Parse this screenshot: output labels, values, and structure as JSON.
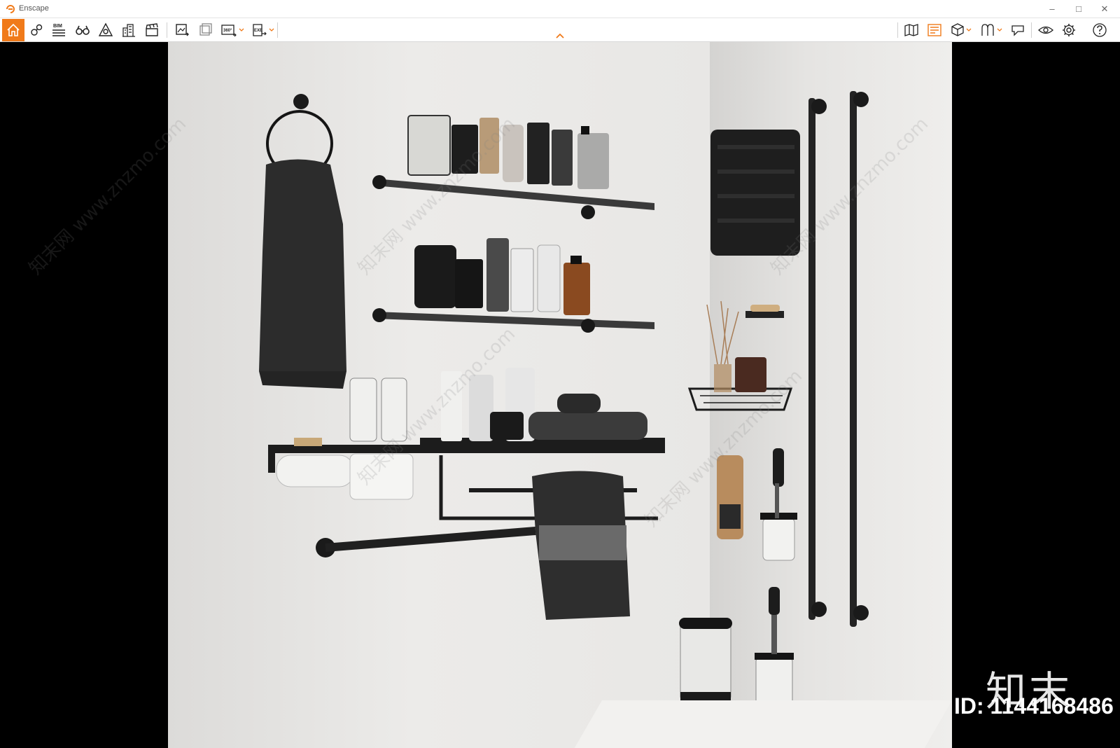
{
  "window": {
    "title": "Enscape",
    "controls": {
      "minimize": "–",
      "maximize": "□",
      "close": "✕"
    }
  },
  "toolbar": {
    "left_icons": [
      "home-icon",
      "visual-settings-icon",
      "bim-icon",
      "binoculars-icon",
      "safe-frame-icon",
      "buildings-icon",
      "clapboard-icon",
      "screenshot-icon",
      "batch-render-icon",
      "panorama-360-icon",
      "export-exe-icon"
    ],
    "right_icons": [
      "map-icon",
      "asset-library-icon",
      "cube-icon",
      "material-editor-icon",
      "feedback-icon",
      "eye-icon",
      "settings-icon",
      "help-icon"
    ],
    "bim_label": "BIM",
    "pano_label": "360°",
    "exe_label": "EXE",
    "accent": "#f07a1a"
  },
  "viewport": {
    "watermark_logo": "知末",
    "watermark_id": "ID: 1144168486",
    "watermark_site": "知末网 www.znzmo.com"
  }
}
